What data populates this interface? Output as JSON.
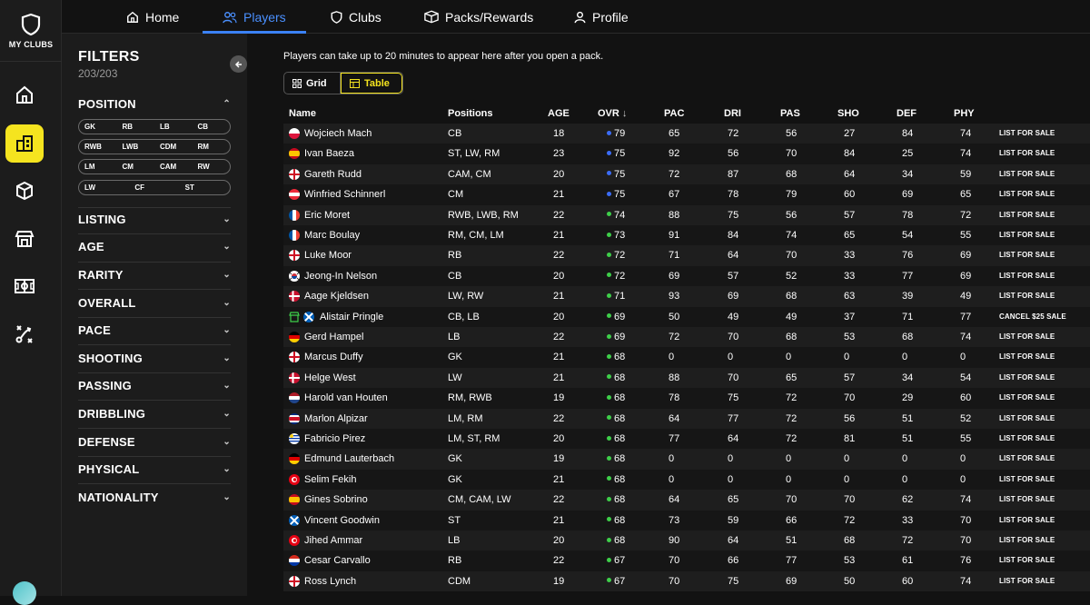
{
  "brand": {
    "logo_text": "MY CLUBS"
  },
  "nav": {
    "tabs": [
      {
        "label": "Home",
        "icon": "home-icon",
        "active": false
      },
      {
        "label": "Players",
        "icon": "players-icon",
        "active": true
      },
      {
        "label": "Clubs",
        "icon": "shield-icon",
        "active": false
      },
      {
        "label": "Packs/Rewards",
        "icon": "packs-icon",
        "active": false
      },
      {
        "label": "Profile",
        "icon": "profile-icon",
        "active": false
      }
    ]
  },
  "sidebar_icons": [
    "home-icon",
    "club-building-icon",
    "cube-icon",
    "store-icon",
    "pitch-icon",
    "tactics-icon"
  ],
  "filters": {
    "title": "FILTERS",
    "count": "203/203",
    "position_label": "POSITION",
    "position_rows": [
      [
        "GK",
        "RB",
        "LB",
        "CB"
      ],
      [
        "RWB",
        "LWB",
        "CDM",
        "RM"
      ],
      [
        "LM",
        "CM",
        "CAM",
        "RW"
      ],
      [
        "LW",
        "CF",
        "ST"
      ]
    ],
    "sections": [
      "LISTING",
      "AGE",
      "RARITY",
      "OVERALL",
      "PACE",
      "SHOOTING",
      "PASSING",
      "DRIBBLING",
      "DEFENSE",
      "PHYSICAL",
      "NATIONALITY"
    ]
  },
  "main": {
    "notice": "Players can take up to 20 minutes to appear here after you open a pack.",
    "view_grid": "Grid",
    "view_table": "Table"
  },
  "table": {
    "headers": [
      "Name",
      "Positions",
      "AGE",
      "OVR",
      "PAC",
      "DRI",
      "PAS",
      "SHO",
      "DEF",
      "PHY"
    ],
    "sort_indicator": "↓",
    "colors": {
      "rare": "#3b6cf6",
      "common": "#3ecf4a",
      "accent": "#f5e41f"
    },
    "rows": [
      {
        "name": "Wojciech Mach",
        "flag": "poland",
        "pos": "CB",
        "age": "18",
        "ovr": "79",
        "tier": "rare",
        "pac": "65",
        "dri": "72",
        "pas": "56",
        "sho": "27",
        "def": "84",
        "phy": "74",
        "action": "LIST FOR SALE"
      },
      {
        "name": "Ivan Baeza",
        "flag": "spain",
        "pos": "ST, LW, RM",
        "age": "23",
        "ovr": "75",
        "tier": "rare",
        "pac": "92",
        "dri": "56",
        "pas": "70",
        "sho": "84",
        "def": "25",
        "phy": "74",
        "action": "LIST FOR SALE"
      },
      {
        "name": "Gareth Rudd",
        "flag": "england",
        "pos": "CAM, CM",
        "age": "20",
        "ovr": "75",
        "tier": "rare",
        "pac": "72",
        "dri": "87",
        "pas": "68",
        "sho": "64",
        "def": "34",
        "phy": "59",
        "action": "LIST FOR SALE"
      },
      {
        "name": "Winfried Schinnerl",
        "flag": "austria",
        "pos": "CM",
        "age": "21",
        "ovr": "75",
        "tier": "rare",
        "pac": "67",
        "dri": "78",
        "pas": "79",
        "sho": "60",
        "def": "69",
        "phy": "65",
        "action": "LIST FOR SALE"
      },
      {
        "name": "Eric Moret",
        "flag": "france",
        "pos": "RWB, LWB, RM",
        "age": "22",
        "ovr": "74",
        "tier": "common",
        "pac": "88",
        "dri": "75",
        "pas": "56",
        "sho": "57",
        "def": "78",
        "phy": "72",
        "action": "LIST FOR SALE"
      },
      {
        "name": "Marc Boulay",
        "flag": "france",
        "pos": "RM, CM, LM",
        "age": "21",
        "ovr": "73",
        "tier": "common",
        "pac": "91",
        "dri": "84",
        "pas": "74",
        "sho": "65",
        "def": "54",
        "phy": "55",
        "action": "LIST FOR SALE"
      },
      {
        "name": "Luke Moor",
        "flag": "england",
        "pos": "RB",
        "age": "22",
        "ovr": "72",
        "tier": "common",
        "pac": "71",
        "dri": "64",
        "pas": "70",
        "sho": "33",
        "def": "76",
        "phy": "69",
        "action": "LIST FOR SALE"
      },
      {
        "name": "Jeong-In Nelson",
        "flag": "korea",
        "pos": "CB",
        "age": "20",
        "ovr": "72",
        "tier": "common",
        "pac": "69",
        "dri": "57",
        "pas": "52",
        "sho": "33",
        "def": "77",
        "phy": "69",
        "action": "LIST FOR SALE"
      },
      {
        "name": "Aage Kjeldsen",
        "flag": "denmark",
        "pos": "LW, RW",
        "age": "21",
        "ovr": "71",
        "tier": "common",
        "pac": "93",
        "dri": "69",
        "pas": "68",
        "sho": "63",
        "def": "39",
        "phy": "49",
        "action": "LIST FOR SALE"
      },
      {
        "name": "Alistair Pringle",
        "flag": "scotland",
        "pos": "CB, LB",
        "age": "20",
        "ovr": "69",
        "tier": "common",
        "pac": "50",
        "dri": "49",
        "pas": "49",
        "sho": "37",
        "def": "71",
        "phy": "77",
        "action": "CANCEL $25 SALE",
        "listed": true
      },
      {
        "name": "Gerd Hampel",
        "flag": "germany",
        "pos": "LB",
        "age": "22",
        "ovr": "69",
        "tier": "common",
        "pac": "72",
        "dri": "70",
        "pas": "68",
        "sho": "53",
        "def": "68",
        "phy": "74",
        "action": "LIST FOR SALE"
      },
      {
        "name": "Marcus Duffy",
        "flag": "england",
        "pos": "GK",
        "age": "21",
        "ovr": "68",
        "tier": "common",
        "pac": "0",
        "dri": "0",
        "pas": "0",
        "sho": "0",
        "def": "0",
        "phy": "0",
        "action": "LIST FOR SALE"
      },
      {
        "name": "Helge West",
        "flag": "denmark",
        "pos": "LW",
        "age": "21",
        "ovr": "68",
        "tier": "common",
        "pac": "88",
        "dri": "70",
        "pas": "65",
        "sho": "57",
        "def": "34",
        "phy": "54",
        "action": "LIST FOR SALE"
      },
      {
        "name": "Harold van Houten",
        "flag": "netherlands",
        "pos": "RM, RWB",
        "age": "19",
        "ovr": "68",
        "tier": "common",
        "pac": "78",
        "dri": "75",
        "pas": "72",
        "sho": "70",
        "def": "29",
        "phy": "60",
        "action": "LIST FOR SALE"
      },
      {
        "name": "Marlon Alpizar",
        "flag": "costarica",
        "pos": "LM, RM",
        "age": "22",
        "ovr": "68",
        "tier": "common",
        "pac": "64",
        "dri": "77",
        "pas": "72",
        "sho": "56",
        "def": "51",
        "phy": "52",
        "action": "LIST FOR SALE"
      },
      {
        "name": "Fabricio Pirez",
        "flag": "uruguay",
        "pos": "LM, ST, RM",
        "age": "20",
        "ovr": "68",
        "tier": "common",
        "pac": "77",
        "dri": "64",
        "pas": "72",
        "sho": "81",
        "def": "51",
        "phy": "55",
        "action": "LIST FOR SALE"
      },
      {
        "name": "Edmund Lauterbach",
        "flag": "germany",
        "pos": "GK",
        "age": "19",
        "ovr": "68",
        "tier": "common",
        "pac": "0",
        "dri": "0",
        "pas": "0",
        "sho": "0",
        "def": "0",
        "phy": "0",
        "action": "LIST FOR SALE"
      },
      {
        "name": "Selim Fekih",
        "flag": "tunisia",
        "pos": "GK",
        "age": "21",
        "ovr": "68",
        "tier": "common",
        "pac": "0",
        "dri": "0",
        "pas": "0",
        "sho": "0",
        "def": "0",
        "phy": "0",
        "action": "LIST FOR SALE"
      },
      {
        "name": "Gines Sobrino",
        "flag": "spain",
        "pos": "CM, CAM, LW",
        "age": "22",
        "ovr": "68",
        "tier": "common",
        "pac": "64",
        "dri": "65",
        "pas": "70",
        "sho": "70",
        "def": "62",
        "phy": "74",
        "action": "LIST FOR SALE"
      },
      {
        "name": "Vincent Goodwin",
        "flag": "scotland",
        "pos": "ST",
        "age": "21",
        "ovr": "68",
        "tier": "common",
        "pac": "73",
        "dri": "59",
        "pas": "66",
        "sho": "72",
        "def": "33",
        "phy": "70",
        "action": "LIST FOR SALE"
      },
      {
        "name": "Jihed Ammar",
        "flag": "tunisia",
        "pos": "LB",
        "age": "20",
        "ovr": "68",
        "tier": "common",
        "pac": "90",
        "dri": "64",
        "pas": "51",
        "sho": "68",
        "def": "72",
        "phy": "70",
        "action": "LIST FOR SALE"
      },
      {
        "name": "Cesar Carvallo",
        "flag": "paraguay",
        "pos": "RB",
        "age": "22",
        "ovr": "67",
        "tier": "common",
        "pac": "70",
        "dri": "66",
        "pas": "77",
        "sho": "53",
        "def": "61",
        "phy": "76",
        "action": "LIST FOR SALE"
      },
      {
        "name": "Ross Lynch",
        "flag": "england",
        "pos": "CDM",
        "age": "19",
        "ovr": "67",
        "tier": "common",
        "pac": "70",
        "dri": "75",
        "pas": "69",
        "sho": "50",
        "def": "60",
        "phy": "74",
        "action": "LIST FOR SALE"
      }
    ]
  }
}
